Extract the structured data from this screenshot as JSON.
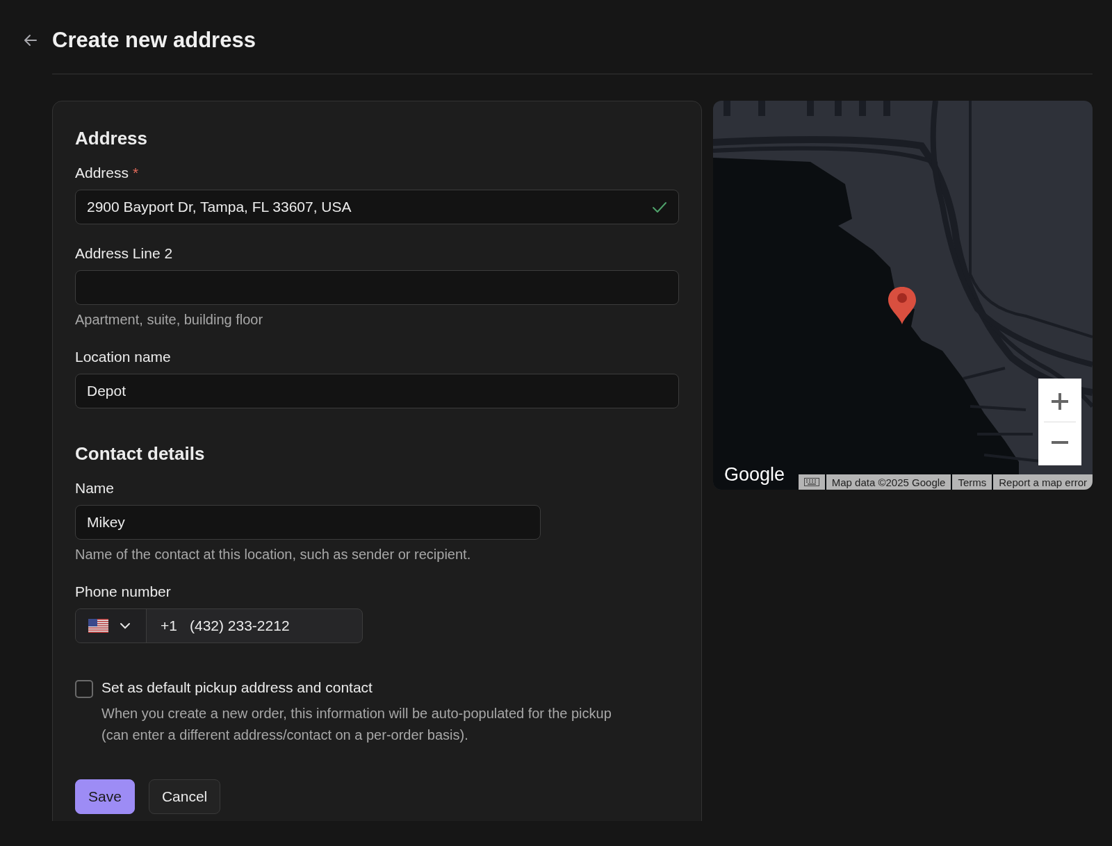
{
  "header": {
    "title": "Create new address"
  },
  "sections": [
    {
      "heading": "Address",
      "fields": [
        {
          "kind": "text",
          "label": "Address",
          "required_mark": "*",
          "value": "2900 Bayport Dr, Tampa, FL 33607, USA",
          "valid": true
        },
        {
          "kind": "text",
          "label": "Address Line 2",
          "help": "Apartment, suite, building floor",
          "valid": false
        },
        {
          "kind": "text",
          "label": "Location name",
          "value": "Depot",
          "valid": false
        }
      ]
    },
    {
      "heading": "Contact details",
      "fields": [
        {
          "kind": "text",
          "label": "Name",
          "value": "Mikey",
          "help": "Name of the contact at this location, such as sender or recipient.",
          "valid": false
        },
        {
          "kind": "phone",
          "label": "Phone number",
          "dial_code": "+1",
          "value": "(432) 233-2212"
        }
      ]
    }
  ],
  "default_checkbox": {
    "label": "Set as default pickup address and contact",
    "description": "When you create a new order, this information will be auto-populated for the pickup (can enter a different address/contact on a per-order basis).",
    "checked": false
  },
  "buttons": [
    {
      "label": "Save",
      "kind": "primary"
    },
    {
      "label": "Cancel",
      "kind": "secondary"
    }
  ],
  "map": {
    "logo": "Google",
    "attribution": [
      "Map data ©2025 Google",
      "Terms",
      "Report a map error"
    ]
  }
}
